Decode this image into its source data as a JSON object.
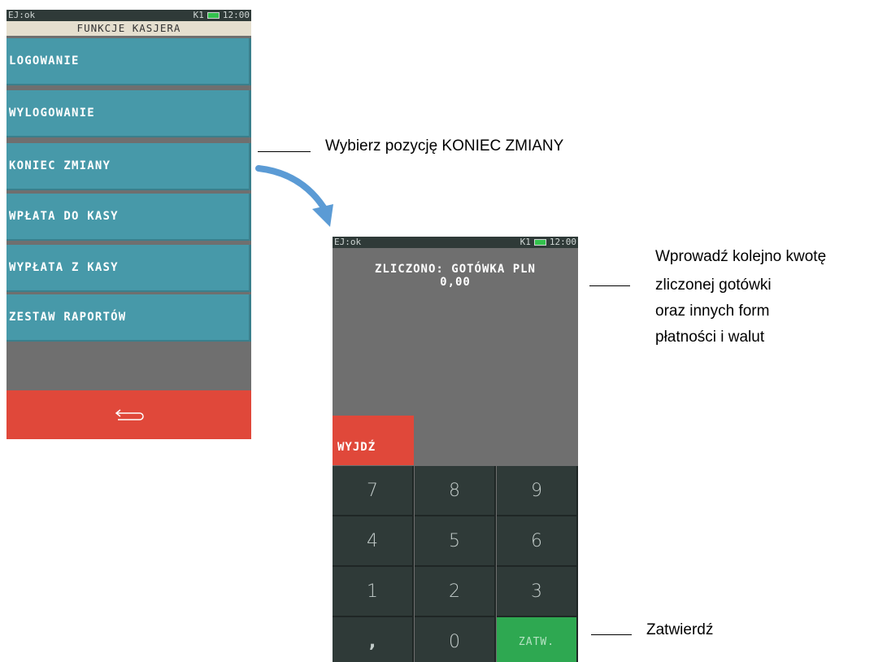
{
  "status": {
    "left": "EJ:ok",
    "right_k": "K1",
    "time": "12:00"
  },
  "screen1": {
    "title": "FUNKCJE KASJERA",
    "menu": [
      {
        "label": "LOGOWANIE"
      },
      {
        "label": "WYLOGOWANIE"
      },
      {
        "label": "KONIEC ZMIANY"
      },
      {
        "label": "WPŁATA DO KASY"
      },
      {
        "label": "WYPŁATA Z KASY"
      },
      {
        "label": "ZESTAW RAPORTÓW"
      }
    ],
    "back_icon": "return-arrow-icon"
  },
  "screen2": {
    "header": "ZLICZONO: GOTÓWKA PLN",
    "value": "0,00",
    "exit_label": "WYJDŹ",
    "keys": [
      "7",
      "8",
      "9",
      "4",
      "5",
      "6",
      "1",
      "2",
      "3",
      ",",
      "0",
      "ZATW."
    ]
  },
  "annotations": {
    "select": "Wybierz pozycję KONIEC ZMIANY",
    "enter_lines": [
      "Wprowadź kolejno kwotę",
      "zliczonej gotówki",
      "oraz innych form",
      "płatności i walut"
    ],
    "confirm": "Zatwierdź"
  },
  "colors": {
    "menu_teal": "#4799a9",
    "back_red": "#e0483a",
    "keypad_dark": "#2f3a38",
    "confirm_green": "#2ea851",
    "arrow_blue": "#5b9bd5"
  }
}
